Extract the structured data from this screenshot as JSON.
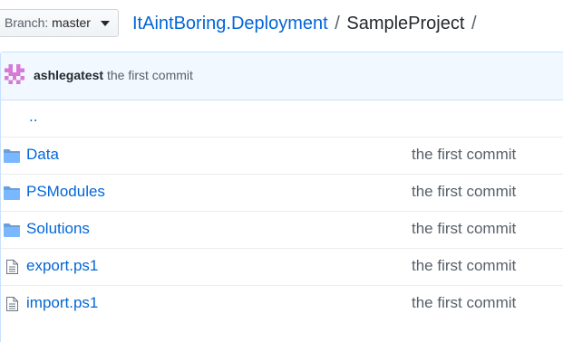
{
  "branch": {
    "label": "Branch:",
    "value": "master"
  },
  "breadcrumb": {
    "repo": "ItAintBoring.Deployment",
    "separator": "/",
    "current": "SampleProject",
    "trailing": "/"
  },
  "latest_commit": {
    "author": "ashlegatest",
    "message": "the first commit"
  },
  "parent_link": "..",
  "files": [
    {
      "name": "Data",
      "type": "folder",
      "commit": "the first commit"
    },
    {
      "name": "PSModules",
      "type": "folder",
      "commit": "the first commit"
    },
    {
      "name": "Solutions",
      "type": "folder",
      "commit": "the first commit"
    },
    {
      "name": "export.ps1",
      "type": "file",
      "commit": "the first commit"
    },
    {
      "name": "import.ps1",
      "type": "file",
      "commit": "the first commit"
    }
  ],
  "colors": {
    "link": "#0366d6",
    "folder_icon": "#79b8ff",
    "commit_bar": "#f1f8ff",
    "muted": "#586069"
  }
}
